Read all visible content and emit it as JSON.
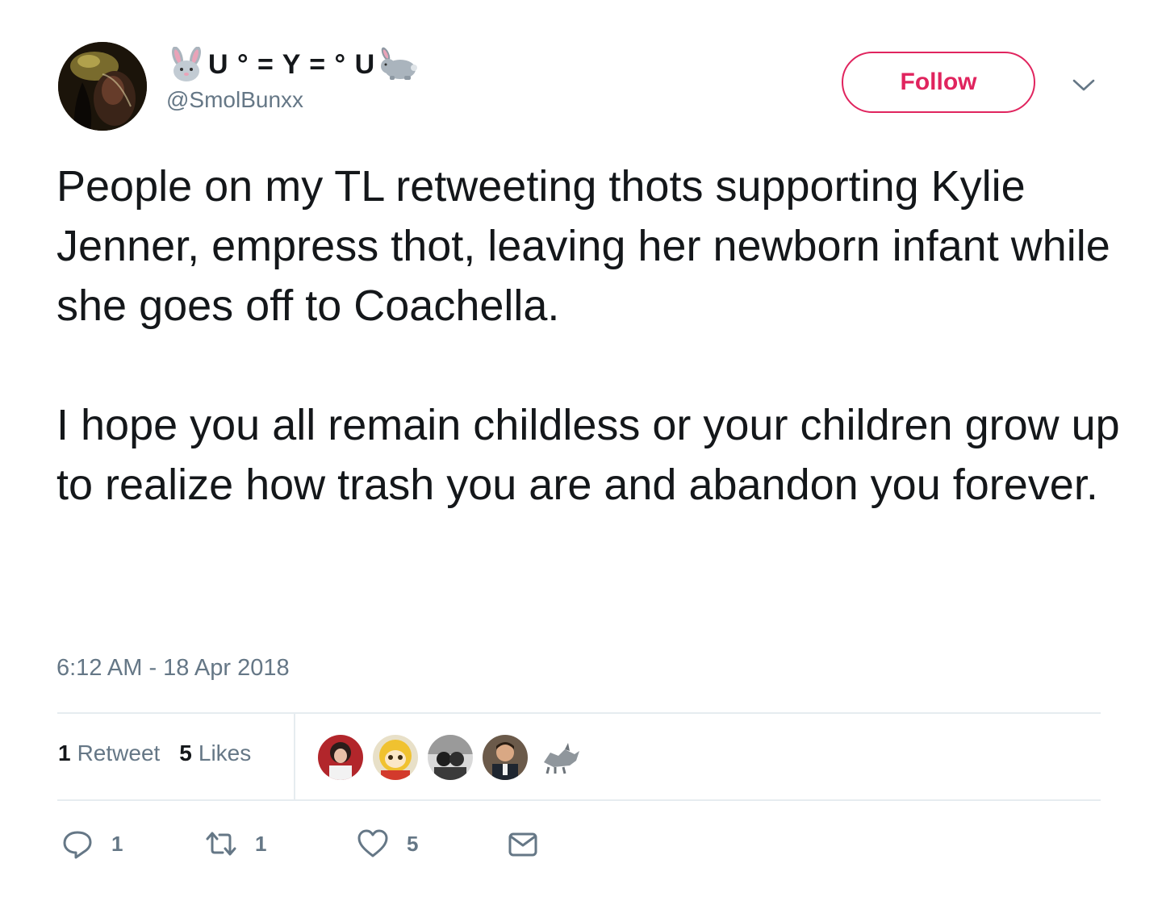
{
  "author": {
    "display_name_text": "U ° = Y = ° U",
    "handle": "@SmolBunxx",
    "leading_emoji": "rabbit-face-icon",
    "trailing_emoji": "rabbit-icon"
  },
  "follow_button": {
    "label": "Follow"
  },
  "tweet": {
    "paragraphs": [
      "People on my TL retweeting thots supporting Kylie Jenner, empress thot, leaving her newborn infant while she goes off to Coachella.",
      "I hope you all remain childless or your children grow up to realize how trash you are and abandon you forever."
    ],
    "timestamp": "6:12 AM - 18 Apr 2018"
  },
  "stats": {
    "retweets_count": "1",
    "retweets_label": "Retweet",
    "likes_count": "5",
    "likes_label": "Likes"
  },
  "actions": {
    "reply_count": "1",
    "retweet_count": "1",
    "like_count": "5"
  },
  "colors": {
    "follow_accent": "#e0245e",
    "text_primary": "#14171a",
    "text_secondary": "#657786",
    "divider": "#e6ecf0"
  }
}
